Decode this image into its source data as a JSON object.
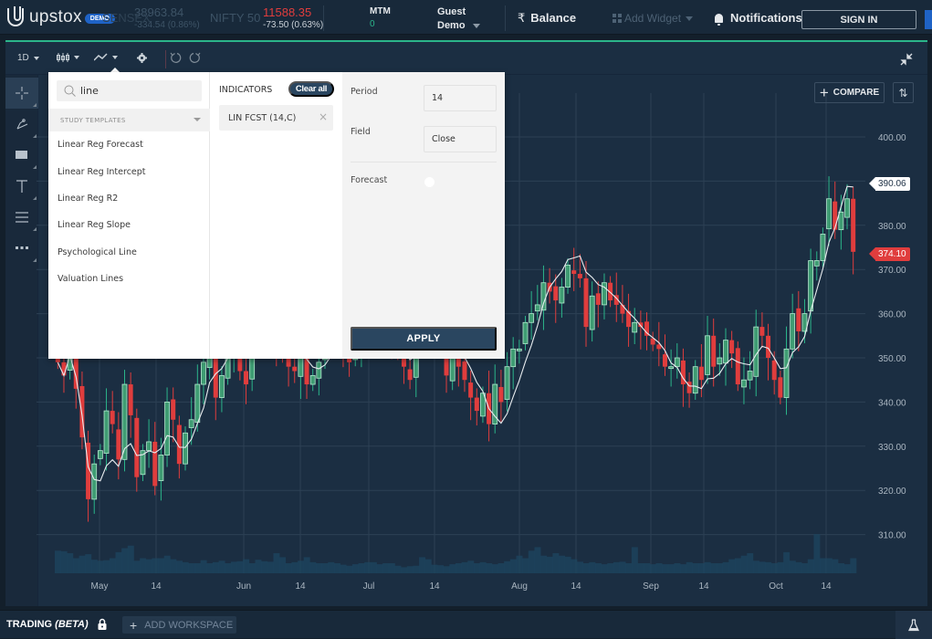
{
  "header": {
    "logo_text": "upstox",
    "demo_badge": "DEMO",
    "tickers": [
      {
        "name": "SENSEX",
        "price": "38963.84",
        "change": "-334.54 (0.86%)",
        "dimmed": true
      },
      {
        "name": "NIFTY 50",
        "price": "11588.35",
        "change": "-73.50 (0.63%)",
        "dimmed": false
      }
    ],
    "mtm_label": "MTM",
    "mtm_value": "0",
    "user_line1": "Guest",
    "user_line2": "Demo",
    "balance_symbol": "₹",
    "balance_label": "Balance",
    "add_widget_label": "Add Widget",
    "notifications_label": "Notifications",
    "sign_in_label": "SIGN IN"
  },
  "toolbar": {
    "interval": "1D",
    "icons": [
      "candle-type-icon",
      "indicator-icon",
      "settings-icon",
      "undo-icon",
      "redo-icon",
      "collapse-icon"
    ],
    "compare_label": "COMPARE"
  },
  "left_tools": [
    "crosshair-icon",
    "draw-tool-icon",
    "rectangle-icon",
    "text-icon",
    "lines-icon",
    "more-icon"
  ],
  "study_panel": {
    "search_value": "line",
    "templates_header": "STUDY TEMPLATES",
    "results": [
      "Linear Reg Forecast",
      "Linear Reg Intercept",
      "Linear Reg R2",
      "Linear Reg Slope",
      "Psychological Line",
      "Valuation Lines"
    ],
    "indicators_title": "INDICATORS",
    "clear_all_label": "Clear all",
    "active_indicators": [
      "LIN FCST (14,C)"
    ],
    "params": {
      "period_label": "Period",
      "period_value": "14",
      "field_label": "Field",
      "field_value": "Close",
      "forecast_label": "Forecast",
      "forecast_enabled": false
    },
    "apply_label": "APPLY"
  },
  "footer": {
    "trading_label": "TRADING",
    "beta_label": "(BETA)",
    "add_workspace_label": "ADD WORKSPACE"
  },
  "colors": {
    "up": "#2bb58a",
    "down": "#e03d3d",
    "background": "#1b2e42",
    "accent": "#2a4660"
  },
  "chart_data": {
    "type": "candlestick",
    "title": "NIFTY 50",
    "interval": "1D",
    "x_tick_labels": [
      "May",
      "14",
      "Jun",
      "14",
      "Jul",
      "14",
      "Aug",
      "14",
      "Sep",
      "14",
      "Oct",
      "14"
    ],
    "y_tick_labels": [
      "400.00",
      "390.00",
      "380.00",
      "370.00",
      "360.00",
      "350.00",
      "340.00",
      "330.00",
      "320.00",
      "310.00"
    ],
    "ylim": [
      305,
      405
    ],
    "last_price": 374.1,
    "indicator_last": 390.06,
    "indicator_name": "LIN FCST (14,C)",
    "grid": true,
    "closes": [
      349,
      346,
      352,
      343,
      332,
      318,
      326,
      329,
      338,
      335,
      327,
      344,
      337,
      323,
      329,
      331,
      321,
      328,
      340,
      336,
      326,
      333,
      336,
      344,
      349,
      351,
      341,
      346,
      350,
      353,
      347,
      344,
      360,
      365,
      357,
      355,
      352,
      351,
      348,
      347,
      352,
      344,
      346,
      349,
      357,
      364,
      359,
      353,
      349,
      353,
      356,
      361,
      359,
      357,
      355,
      353,
      351,
      348,
      345,
      353,
      362,
      364,
      360,
      352,
      346,
      350,
      348,
      345,
      341,
      338,
      342,
      335,
      344,
      340,
      348,
      352,
      352,
      358,
      360,
      362,
      367,
      365,
      363,
      366,
      371,
      369,
      368,
      357,
      364,
      362,
      367,
      363,
      362,
      360,
      357,
      358,
      357,
      355,
      353,
      352,
      348,
      348,
      350,
      344,
      342,
      348,
      345,
      355,
      348,
      350,
      354,
      351,
      344,
      345,
      347,
      357,
      355,
      350,
      345,
      341,
      352,
      360,
      356,
      360,
      372,
      372,
      378,
      386,
      379,
      383,
      386,
      374
    ],
    "volume_relative": [
      0.45,
      0.44,
      0.4,
      0.3,
      0.35,
      0.38,
      0.27,
      0.25,
      0.26,
      0.3,
      0.42,
      0.5,
      0.55,
      0.25,
      0.3,
      0.28,
      0.3,
      0.3,
      0.35,
      0.28,
      0.25,
      0.22,
      0.2,
      0.2,
      0.26,
      0.2,
      0.22,
      0.25,
      0.2,
      0.23,
      0.24,
      0.28,
      0.2,
      0.27,
      0.24,
      0.23,
      0.4,
      0.32,
      0.2,
      0.22,
      0.25,
      0.32,
      0.22,
      0.2,
      0.2,
      0.22,
      0.2,
      0.17,
      0.15,
      0.18,
      0.2,
      0.22,
      0.22,
      0.18,
      0.2,
      0.2,
      0.15,
      0.12,
      0.14,
      0.15,
      0.32,
      0.28,
      0.17,
      0.16,
      0.14,
      0.18,
      0.2,
      0.22,
      0.25,
      0.2,
      0.22,
      0.2,
      0.18,
      0.2,
      0.24,
      0.28,
      0.35,
      0.3,
      0.45,
      0.52,
      0.35,
      0.33,
      0.4,
      0.35,
      0.33,
      0.28,
      0.23,
      0.2,
      0.22,
      0.2,
      0.18,
      0.2,
      0.22,
      0.23,
      0.2,
      0.52,
      0.2,
      0.2,
      0.18,
      0.2,
      0.18,
      0.18,
      0.2,
      0.18,
      0.22,
      0.2,
      0.2,
      0.22,
      0.2,
      0.2,
      0.22,
      0.28,
      0.3,
      0.35,
      0.4,
      0.25,
      0.23,
      0.22,
      0.2,
      0.22,
      0.42,
      0.25,
      0.22,
      0.2,
      0.28,
      0.78,
      0.3,
      0.3,
      0.28,
      0.2,
      0.18,
      0.3
    ]
  }
}
